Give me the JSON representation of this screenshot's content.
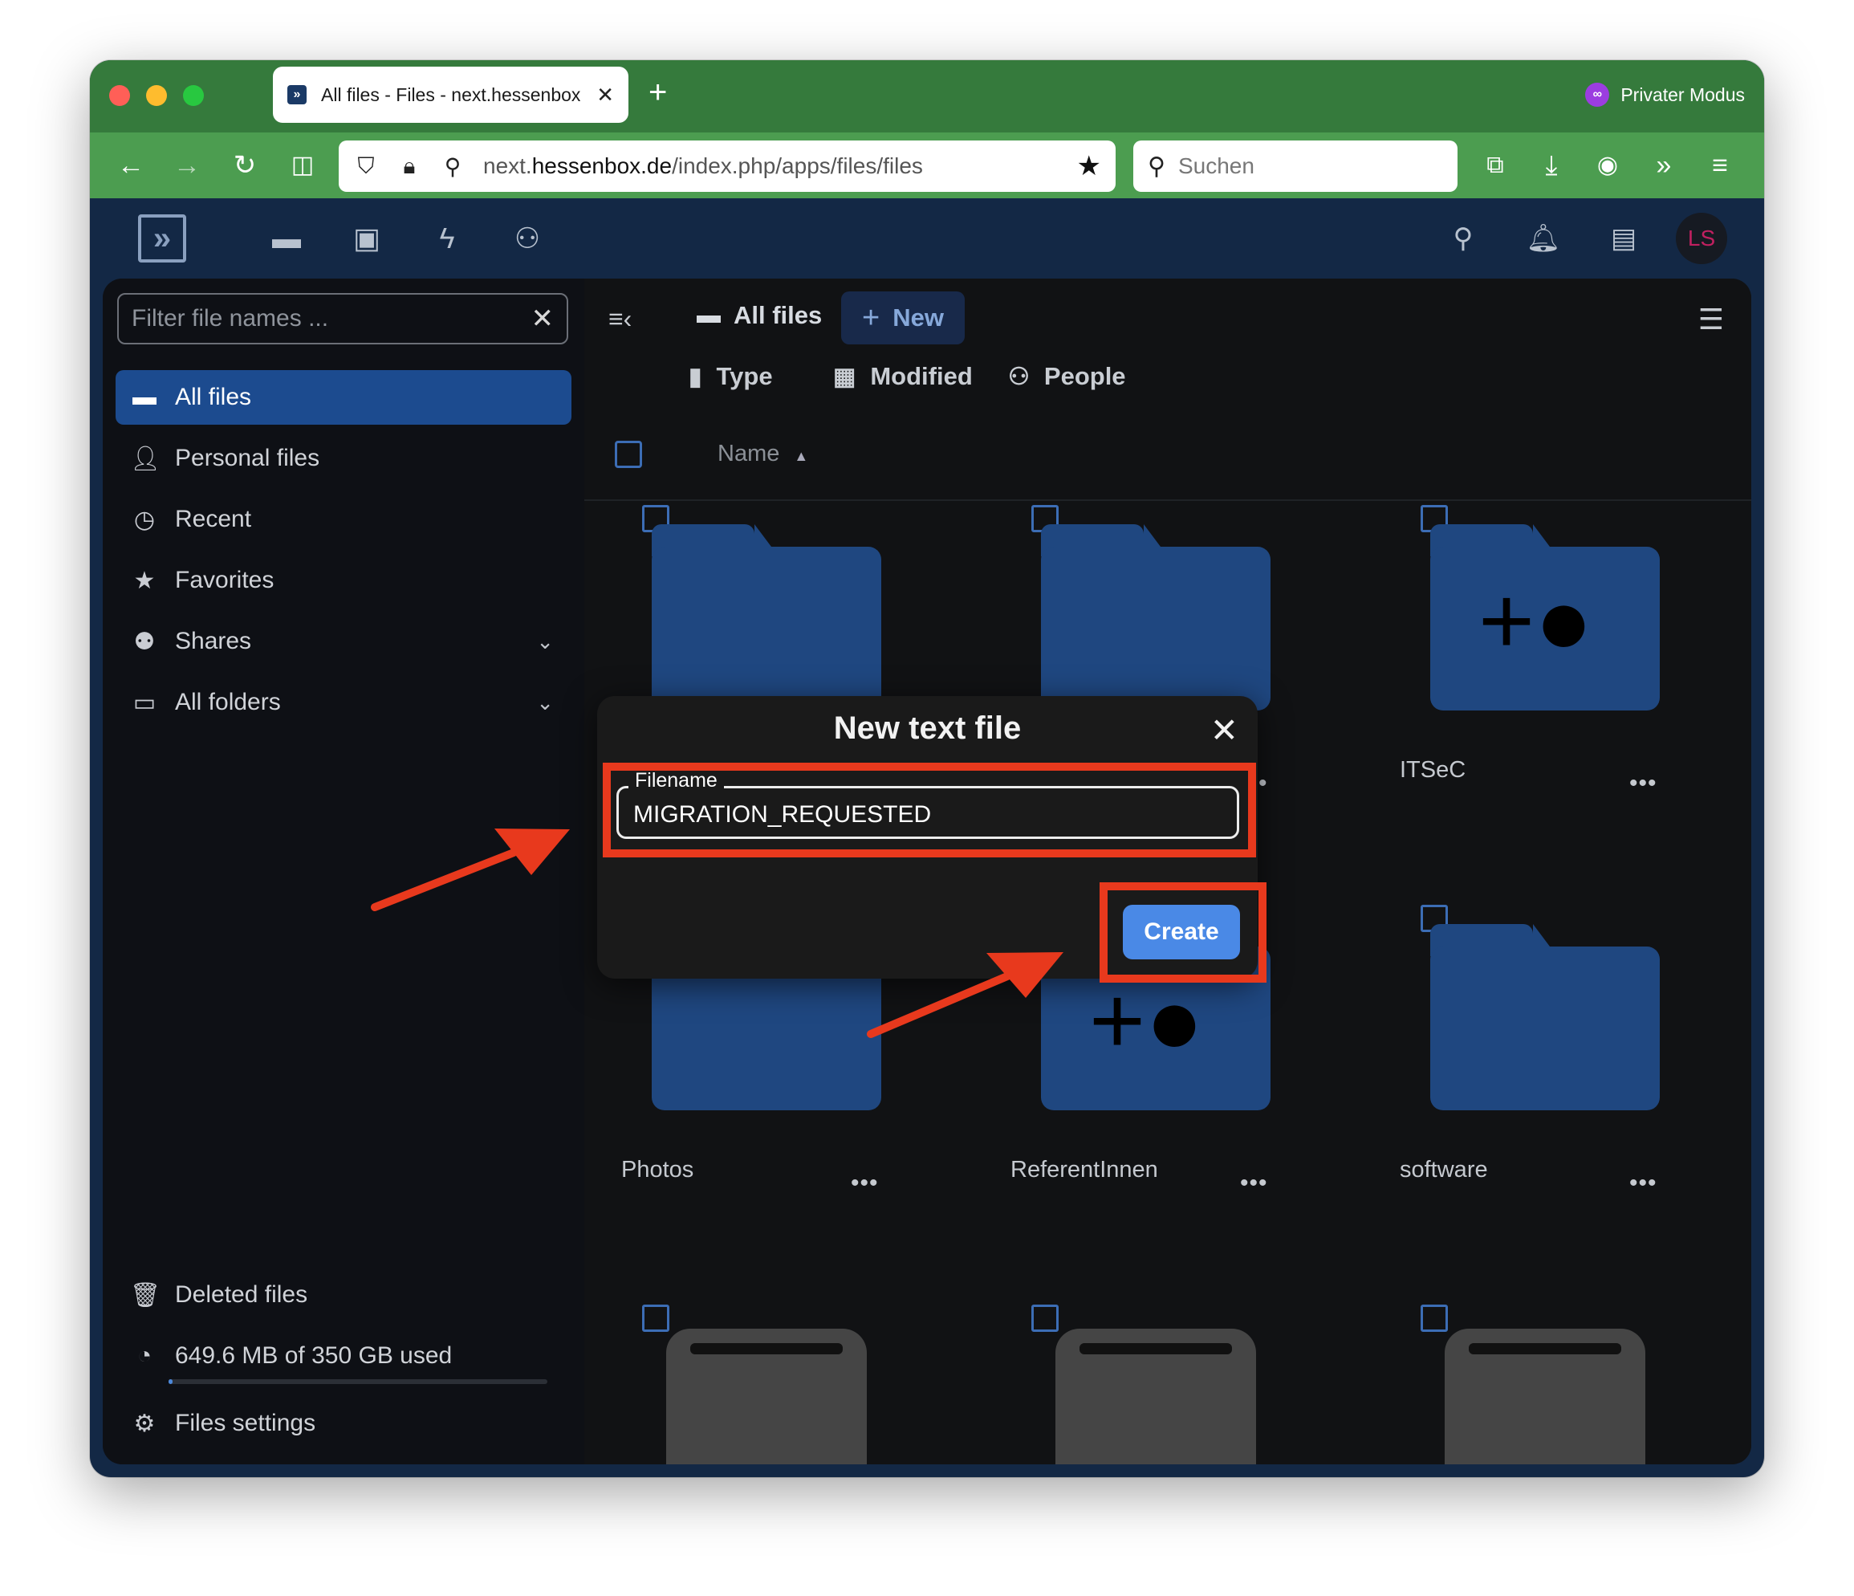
{
  "browser": {
    "tab_title": "All files - Files - next.hessenbox",
    "tab_close": "✕",
    "new_tab": "+",
    "private_mode": "Privater Modus",
    "url_domain_prefix": "next.",
    "url_domain": "hessenbox.de",
    "url_path": "/index.php/apps/files/files",
    "search_placeholder": "Suchen"
  },
  "header": {
    "avatar_initials": "LS"
  },
  "sidebar": {
    "filter_placeholder": "Filter file names ...",
    "items": [
      {
        "label": "All files",
        "icon": "folder-icon",
        "active": true
      },
      {
        "label": "Personal files",
        "icon": "person-icon"
      },
      {
        "label": "Recent",
        "icon": "history-icon"
      },
      {
        "label": "Favorites",
        "icon": "star-icon"
      },
      {
        "label": "Shares",
        "icon": "share-icon"
      },
      {
        "label": "All folders",
        "icon": "folders-icon"
      }
    ],
    "deleted": "Deleted files",
    "quota": "649.6 MB of 350 GB used",
    "quota_fraction": 0.0019,
    "settings": "Files settings"
  },
  "main": {
    "breadcrumb": "All files",
    "new_button": "New",
    "filters": [
      "Type",
      "Modified",
      "People"
    ],
    "name_column": "Name",
    "files": [
      {
        "name": "",
        "kind": "folder"
      },
      {
        "name": "",
        "kind": "folder"
      },
      {
        "name": "ITSeC",
        "kind": "shared-folder"
      },
      {
        "name": "Photos",
        "kind": "folder"
      },
      {
        "name": "ReferentInnen",
        "kind": "shared-folder"
      },
      {
        "name": "software",
        "kind": "folder"
      },
      {
        "name": "",
        "kind": "external-drive"
      },
      {
        "name": "",
        "kind": "external-drive"
      },
      {
        "name": "",
        "kind": "external-drive"
      }
    ],
    "more": "•••"
  },
  "modal": {
    "title": "New text file",
    "field_label": "Filename",
    "field_value": "MIGRATION_REQUESTED",
    "create_button": "Create"
  },
  "colors": {
    "accent": "#e8391d",
    "primary": "#4a89e6",
    "folder": "#1f4780"
  }
}
